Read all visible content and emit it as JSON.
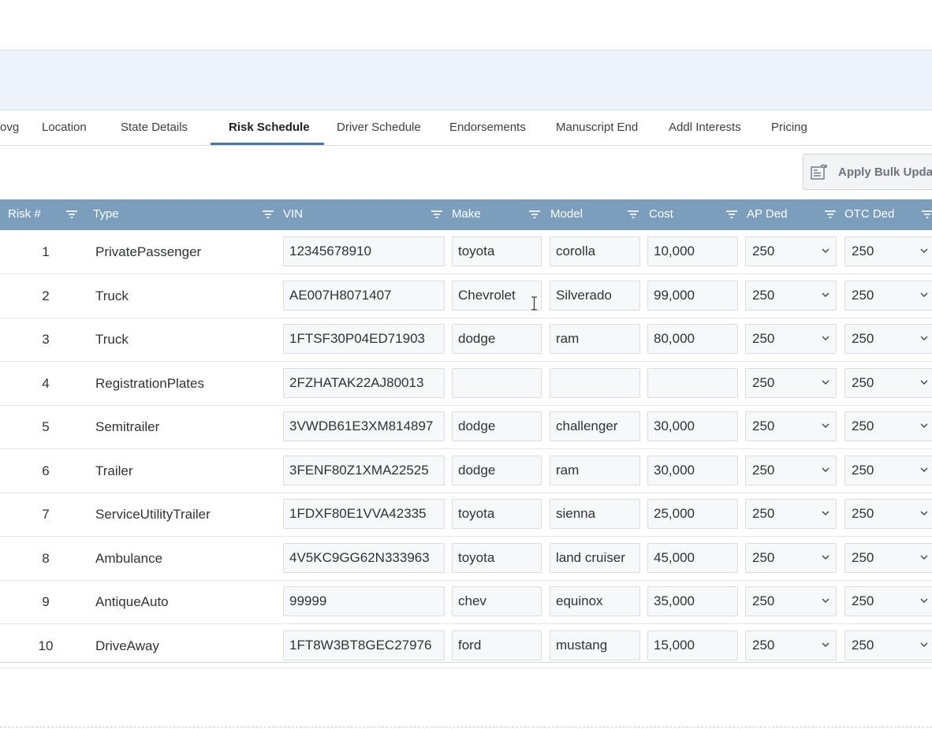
{
  "tabs": [
    {
      "label": "ovg"
    },
    {
      "label": "Location"
    },
    {
      "label": "State Details"
    },
    {
      "label": "Risk Schedule"
    },
    {
      "label": "Driver Schedule"
    },
    {
      "label": "Endorsements"
    },
    {
      "label": "Manuscript End"
    },
    {
      "label": "Addl Interests"
    },
    {
      "label": "Pricing"
    }
  ],
  "active_tab": "Risk Schedule",
  "toolbar": {
    "bulk_update_label": "Apply Bulk Updat",
    "bulk_update_icon": "bulk-update-icon"
  },
  "columns": [
    {
      "label": "Risk #"
    },
    {
      "label": "Type"
    },
    {
      "label": "VIN"
    },
    {
      "label": "Make"
    },
    {
      "label": "Model"
    },
    {
      "label": "Cost"
    },
    {
      "label": "AP Ded"
    },
    {
      "label": "OTC Ded"
    }
  ],
  "rows": [
    {
      "risk": "1",
      "type": "PrivatePassenger",
      "vin": "12345678910",
      "make": "toyota",
      "model": "corolla",
      "cost": "10,000",
      "ap_ded": "250",
      "otc_ded": "250"
    },
    {
      "risk": "2",
      "type": "Truck",
      "vin": "AE007H8071407",
      "make": "Chevrolet",
      "model": "Silverado",
      "cost": "99,000",
      "ap_ded": "250",
      "otc_ded": "250"
    },
    {
      "risk": "3",
      "type": "Truck",
      "vin": "1FTSF30P04ED71903",
      "make": "dodge",
      "model": "ram",
      "cost": "80,000",
      "ap_ded": "250",
      "otc_ded": "250"
    },
    {
      "risk": "4",
      "type": "RegistrationPlates",
      "vin": "2FZHATAK22AJ80013",
      "make": "",
      "model": "",
      "cost": "",
      "ap_ded": "250",
      "otc_ded": "250"
    },
    {
      "risk": "5",
      "type": "Semitrailer",
      "vin": "3VWDB61E3XM814897",
      "make": "dodge",
      "model": "challenger",
      "cost": "30,000",
      "ap_ded": "250",
      "otc_ded": "250"
    },
    {
      "risk": "6",
      "type": "Trailer",
      "vin": "3FENF80Z1XMA22525",
      "make": "dodge",
      "model": "ram",
      "cost": "30,000",
      "ap_ded": "250",
      "otc_ded": "250"
    },
    {
      "risk": "7",
      "type": "ServiceUtilityTrailer",
      "vin": "1FDXF80E1VVA42335",
      "make": "toyota",
      "model": "sienna",
      "cost": "25,000",
      "ap_ded": "250",
      "otc_ded": "250"
    },
    {
      "risk": "8",
      "type": "Ambulance",
      "vin": "4V5KC9GG62N333963",
      "make": "toyota",
      "model": "land cruiser",
      "cost": "45,000",
      "ap_ded": "250",
      "otc_ded": "250"
    },
    {
      "risk": "9",
      "type": "AntiqueAuto",
      "vin": "99999",
      "make": "chev",
      "model": "equinox",
      "cost": "35,000",
      "ap_ded": "250",
      "otc_ded": "250"
    },
    {
      "risk": "10",
      "type": "DriveAway",
      "vin": "1FT8W3BT8GEC27976",
      "make": "ford",
      "model": "mustang",
      "cost": "15,000",
      "ap_ded": "250",
      "otc_ded": "250"
    }
  ],
  "colors": {
    "header_bg": "#7b9ebd",
    "active_tab_underline": "#2a7ecb",
    "band_bg": "#eef3f9"
  }
}
